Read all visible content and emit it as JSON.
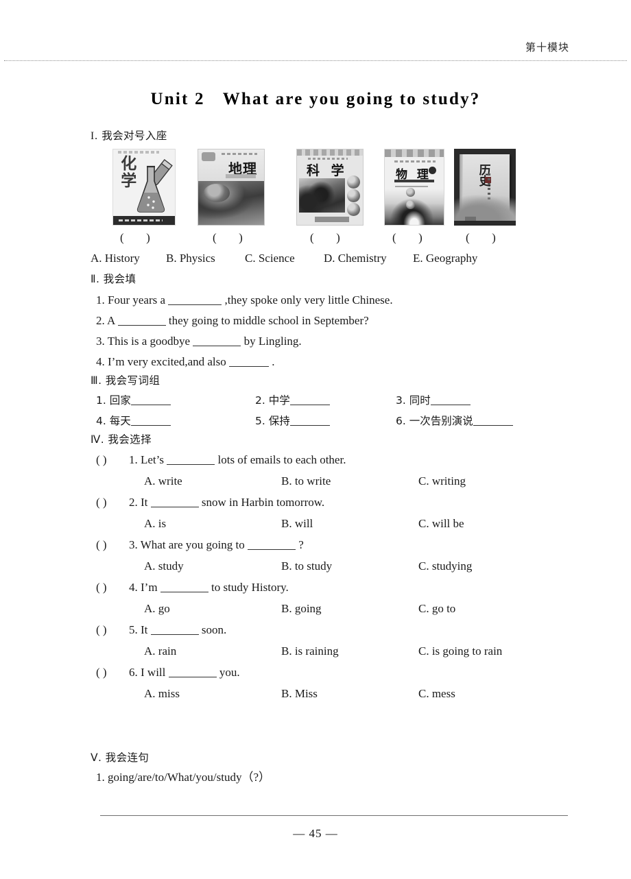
{
  "header": {
    "running_head": "第十模块"
  },
  "title": {
    "unit": "Unit 2",
    "question": "What are you going to study?"
  },
  "section1": {
    "heading_roman": "I",
    "heading_text": ". 我会对号入座",
    "books": [
      {
        "subject_cn": "化学",
        "subject_en": "Chemistry",
        "answer": "(      )"
      },
      {
        "subject_cn": "地理",
        "subject_en": "Geography",
        "answer": "(      )"
      },
      {
        "subject_cn": "科 学",
        "subject_en": "Science",
        "answer": "(      )"
      },
      {
        "subject_cn": "物 理",
        "subject_en": "Physics",
        "answer": "(      )"
      },
      {
        "subject_cn": "历史",
        "subject_en": "History",
        "answer": "(      )"
      }
    ],
    "options": [
      "A. History",
      "B. Physics",
      "C. Science",
      "D. Chemistry",
      "E. Geography"
    ]
  },
  "section2": {
    "heading_roman": "Ⅱ",
    "heading_text": ". 我会填",
    "questions": [
      {
        "pre": "1. Four years a ",
        "post": " ,they spoke only very little Chinese."
      },
      {
        "pre": "2. A ",
        "post": " they going to middle school in September?"
      },
      {
        "pre": "3. This is a goodbye ",
        "post": " by Lingling."
      },
      {
        "pre": "4. I’m very excited,and also ",
        "post": " ."
      }
    ]
  },
  "section3": {
    "heading_roman": "Ⅲ",
    "heading_text": ". 我会写词组",
    "items": [
      "1. 回家",
      "2. 中学",
      "3. 同时",
      "4. 每天",
      "5. 保持",
      "6. 一次告别演说"
    ]
  },
  "section4": {
    "heading_roman": "Ⅳ",
    "heading_text": ". 我会选择",
    "questions": [
      {
        "paren": "(     )",
        "pre": "1. Let’s ",
        "post": " lots of emails to each other.",
        "a": "A. write",
        "b": "B. to write",
        "c": "C. writing"
      },
      {
        "paren": "(     )",
        "pre": "2. It ",
        "post": " snow in Harbin tomorrow.",
        "a": "A. is",
        "b": "B. will",
        "c": "C. will be"
      },
      {
        "paren": "(     )",
        "pre": "3. What are you going to ",
        "post": " ?",
        "a": "A. study",
        "b": "B. to study",
        "c": "C. studying"
      },
      {
        "paren": "(     )",
        "pre": "4. I’m ",
        "post": " to study History.",
        "a": "A. go",
        "b": "B. going",
        "c": "C. go to"
      },
      {
        "paren": "(     )",
        "pre": "5. It ",
        "post": " soon.",
        "a": "A. rain",
        "b": "B. is raining",
        "c": "C. is going to rain"
      },
      {
        "paren": "(     )",
        "pre": "6. I will ",
        "post": " you.",
        "a": "A. miss",
        "b": "B. Miss",
        "c": "C. mess"
      }
    ]
  },
  "section5": {
    "heading_roman": "Ⅴ",
    "heading_text": ". 我会连句",
    "questions": [
      "1. going/are/to/What/you/study（?）"
    ]
  },
  "footer": {
    "page_number": "— 45 —"
  }
}
